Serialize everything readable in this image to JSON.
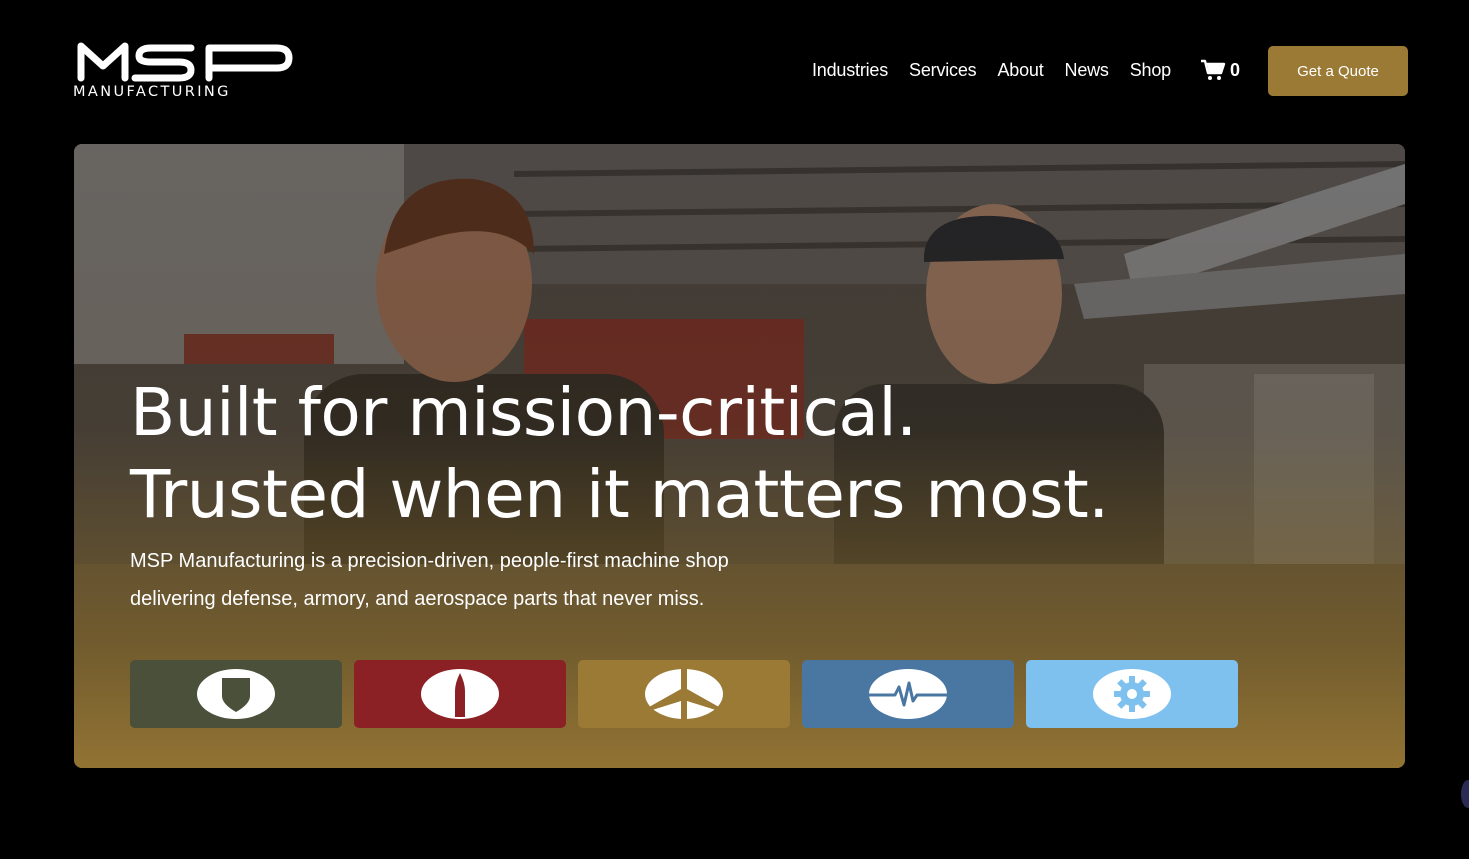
{
  "brand": {
    "logo_text": "MSP",
    "logo_subtext": "MANUFACTURING"
  },
  "nav": {
    "items": [
      {
        "label": "Industries"
      },
      {
        "label": "Services"
      },
      {
        "label": "About"
      },
      {
        "label": "News"
      },
      {
        "label": "Shop"
      }
    ],
    "cart_icon": "cart-icon",
    "cart_count": "0",
    "cta_label": "Get a Quote"
  },
  "hero": {
    "headline_line1": "Built for mission-critical.",
    "headline_line2": "Trusted when it matters most.",
    "subtext_line1": "MSP Manufacturing is a precision-driven, people-first machine shop",
    "subtext_line2": "delivering defense, armory, and aerospace parts that never miss.",
    "tiles": [
      {
        "icon": "shield-icon",
        "color": "#4a5039"
      },
      {
        "icon": "bullet-icon",
        "color": "#8c2125"
      },
      {
        "icon": "airplane-icon",
        "color": "#9a7a35"
      },
      {
        "icon": "heartbeat-icon",
        "color": "#4a76a2"
      },
      {
        "icon": "gear-icon",
        "color": "#7ec1ef"
      }
    ]
  },
  "colors": {
    "accent": "#9b7a35",
    "background": "#000000"
  }
}
